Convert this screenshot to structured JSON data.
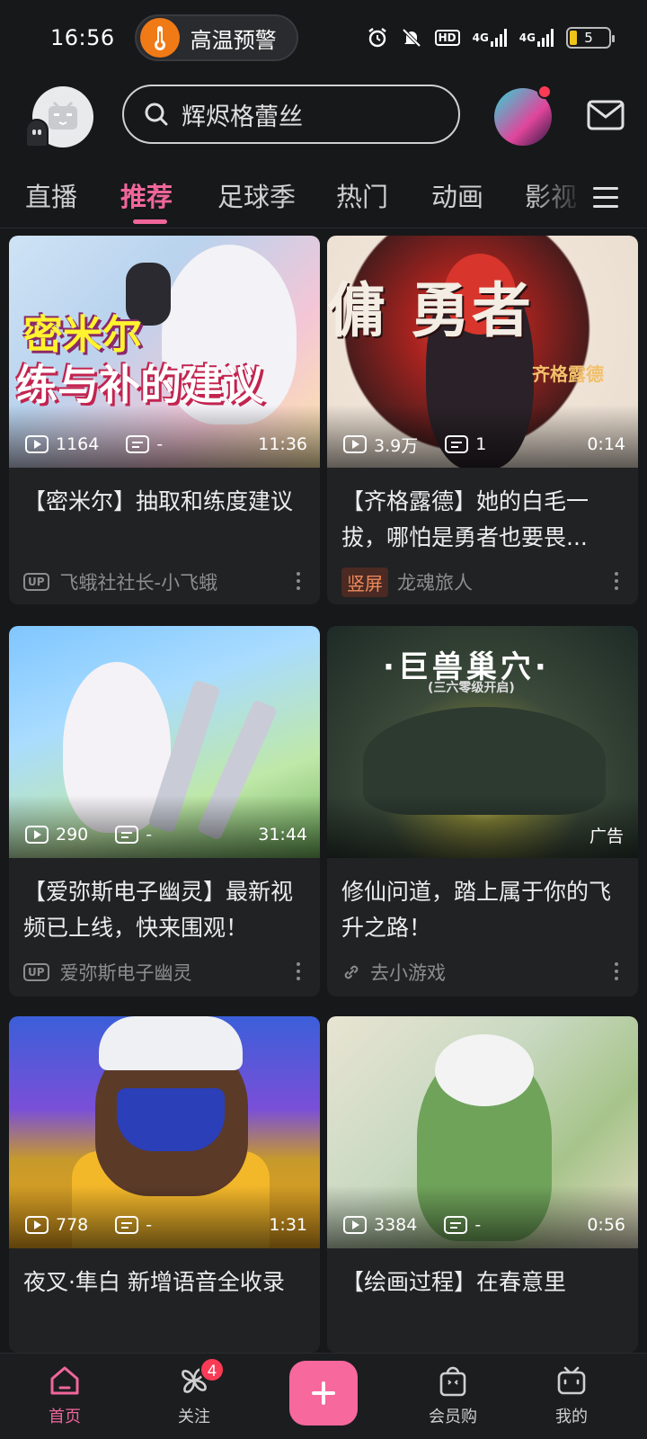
{
  "status_bar": {
    "time": "16:56",
    "alert": "高温预警",
    "hd_label": "HD",
    "signal1_label": "4G",
    "signal2_label": "4G",
    "battery": "5"
  },
  "header": {
    "search_placeholder": "辉烬格蕾丝"
  },
  "tabs": [
    {
      "label": "直播"
    },
    {
      "label": "推荐"
    },
    {
      "label": "足球季"
    },
    {
      "label": "热门"
    },
    {
      "label": "动画"
    },
    {
      "label": "影视"
    }
  ],
  "active_tab": "推荐",
  "feed": [
    {
      "thumb_text_1": "密米尔",
      "thumb_text_2": "练与补的建议",
      "views": "1164",
      "danmaku": "-",
      "duration": "11:36",
      "title": "【密米尔】抽取和练度建议",
      "author": "飞蛾社社长-小飞蛾",
      "author_badge": "UP"
    },
    {
      "thumb_text_1": "傭 勇者",
      "thumb_text_2": "齐格露德",
      "views": "3.9万",
      "danmaku": "1",
      "duration": "0:14",
      "title": "【齐格露德】她的白毛一拔，哪怕是勇者也要畏...",
      "author": "龙魂旅人",
      "author_badge": "竖屏"
    },
    {
      "views": "290",
      "danmaku": "-",
      "duration": "31:44",
      "title": "【爱弥斯电子幽灵】最新视频已上线，快来围观！",
      "author": "爱弥斯电子幽灵",
      "author_badge": "UP"
    },
    {
      "thumb_text_1": "·巨兽巢穴·",
      "thumb_text_2": "(三六零级开启)",
      "ad_label": "广告",
      "title": "修仙问道，踏上属于你的飞升之路！",
      "author": "去小游戏"
    },
    {
      "views": "778",
      "danmaku": "-",
      "duration": "1:31",
      "title": "夜叉·隼白 新增语音全收录"
    },
    {
      "views": "3384",
      "danmaku": "-",
      "duration": "0:56",
      "title": "【绘画过程】在春意里"
    }
  ],
  "bottom_nav": {
    "home": "首页",
    "follow": "关注",
    "follow_badge": "4",
    "vip_shop": "会员购",
    "mine": "我的"
  },
  "colors": {
    "accent": "#f0669a",
    "background": "#17181a",
    "card": "#212224"
  }
}
